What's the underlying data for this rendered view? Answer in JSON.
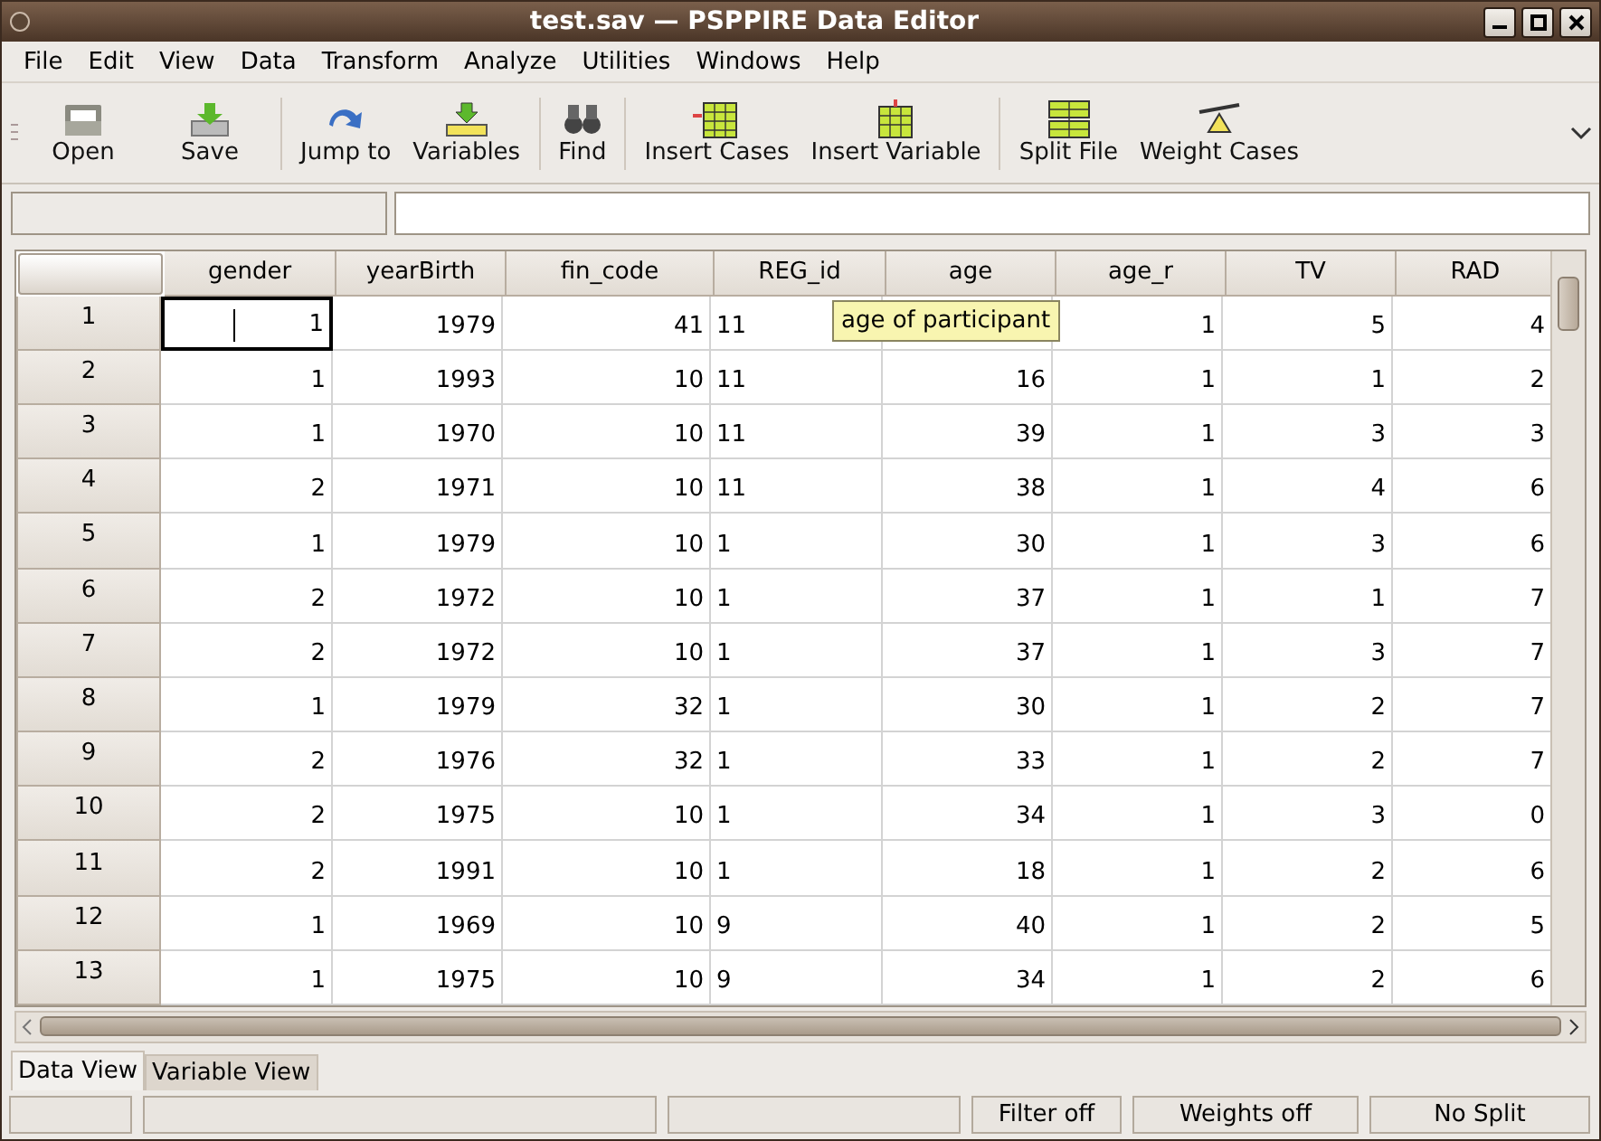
{
  "window": {
    "title": "test.sav — PSPPIRE Data Editor"
  },
  "menu": [
    "File",
    "Edit",
    "View",
    "Data",
    "Transform",
    "Analyze",
    "Utilities",
    "Windows",
    "Help"
  ],
  "toolbar": [
    [
      "Open",
      "Save"
    ],
    [
      "Jump to",
      "Variables"
    ],
    [
      "Find"
    ],
    [
      "Insert Cases",
      "Insert Variable"
    ],
    [
      "Split File",
      "Weight Cases"
    ]
  ],
  "table": {
    "columns": [
      "gender",
      "yearBirth",
      "fin_code",
      "REG_id",
      "age",
      "age_r",
      "TV",
      "RAD"
    ],
    "rows": [
      {
        "number": "1",
        "focused": true,
        "cells": [
          "1",
          "1979",
          "41",
          "11",
          null,
          "1",
          "5",
          "4"
        ]
      },
      {
        "number": "2",
        "focused": false,
        "cells": [
          "1",
          "1993",
          "10",
          "11",
          "16",
          "1",
          "1",
          "2"
        ]
      },
      {
        "number": "3",
        "focused": false,
        "cells": [
          "1",
          "1970",
          "10",
          "11",
          "39",
          "1",
          "3",
          "3"
        ]
      },
      {
        "number": "4",
        "focused": false,
        "cells": [
          "2",
          "1971",
          "10",
          "11",
          "38",
          "1",
          "4",
          "6"
        ]
      },
      {
        "number": "5",
        "focused": false,
        "cells": [
          "1",
          "1979",
          "10",
          "1",
          "30",
          "1",
          "3",
          "6"
        ]
      },
      {
        "number": "6",
        "focused": false,
        "cells": [
          "2",
          "1972",
          "10",
          "1",
          "37",
          "1",
          "1",
          "7"
        ]
      },
      {
        "number": "7",
        "focused": false,
        "cells": [
          "2",
          "1972",
          "10",
          "1",
          "37",
          "1",
          "3",
          "7"
        ]
      },
      {
        "number": "8",
        "focused": false,
        "cells": [
          "1",
          "1979",
          "32",
          "1",
          "30",
          "1",
          "2",
          "7"
        ]
      },
      {
        "number": "9",
        "focused": false,
        "cells": [
          "2",
          "1976",
          "32",
          "1",
          "33",
          "1",
          "2",
          "7"
        ]
      },
      {
        "number": "10",
        "focused": false,
        "cells": [
          "2",
          "1975",
          "10",
          "1",
          "34",
          "1",
          "3",
          "0"
        ]
      },
      {
        "number": "11",
        "focused": false,
        "cells": [
          "2",
          "1991",
          "10",
          "1",
          "18",
          "1",
          "2",
          "6"
        ]
      },
      {
        "number": "12",
        "focused": false,
        "cells": [
          "1",
          "1969",
          "10",
          "9",
          "40",
          "1",
          "2",
          "5"
        ]
      },
      {
        "number": "13",
        "focused": false,
        "cells": [
          "1",
          "1975",
          "10",
          "9",
          "34",
          "1",
          "2",
          "6"
        ]
      }
    ],
    "tooltip": "age of participant"
  },
  "tabs": [
    {
      "label": "Data View",
      "selected": true
    },
    {
      "label": "Variable View",
      "selected": false
    }
  ],
  "status_bar": [
    "Filter off",
    "Weights off",
    "No Split"
  ]
}
